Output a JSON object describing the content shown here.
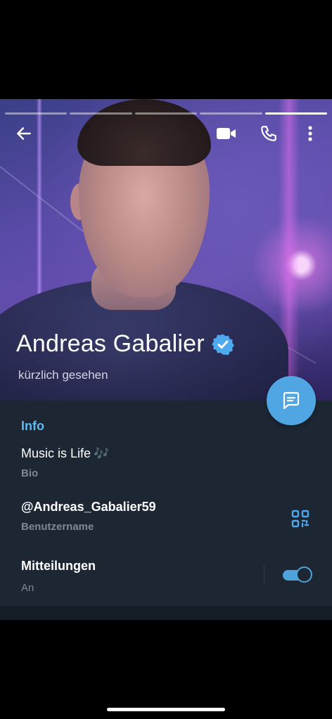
{
  "header": {
    "progress_segments": 5,
    "active_segment": 4,
    "icons": {
      "back": "arrow-left-icon",
      "video": "video-camera-icon",
      "call": "phone-icon",
      "more": "more-vertical-icon"
    }
  },
  "profile": {
    "name": "Andreas Gabalier",
    "verified_icon": "verified-badge-icon",
    "status": "kürzlich gesehen"
  },
  "info": {
    "title": "Info",
    "bio": "Music is Life",
    "bio_emoji": "🎶",
    "bio_label": "Bio",
    "username": "@Andreas_Gabalier59",
    "username_label": "Benutzername",
    "qr_icon": "qr-code-icon",
    "notifications": "Mitteilungen",
    "notifications_value": "An",
    "notifications_enabled": true
  },
  "fab": {
    "icon": "message-icon"
  },
  "colors": {
    "panel_bg": "#1c2733",
    "accent": "#50a6e2",
    "section_title": "#62b8ef",
    "secondary_text": "#7c8895"
  }
}
